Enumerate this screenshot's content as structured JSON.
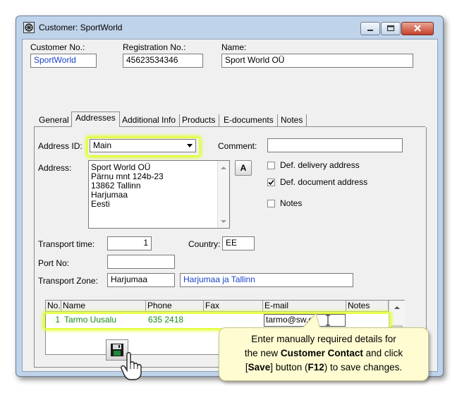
{
  "window": {
    "title": "Customer: SportWorld"
  },
  "header": {
    "customer_no_label": "Customer No.:",
    "customer_no_value": "SportWorld",
    "registration_no_label": "Registration No.:",
    "registration_no_value": "45623534346",
    "name_label": "Name:",
    "name_value": "Sport World OÜ"
  },
  "tabs": [
    {
      "label": "General"
    },
    {
      "label": "Addresses",
      "active": true
    },
    {
      "label": "Additional Info"
    },
    {
      "label": "Products"
    },
    {
      "label": "E-documents"
    },
    {
      "label": "Notes"
    }
  ],
  "address": {
    "address_id_label": "Address ID:",
    "address_id_value": "Main",
    "comment_label": "Comment:",
    "comment_value": "",
    "address_label": "Address:",
    "address_lines": [
      "Sport World OÜ",
      "Pärnu mnt 124b-23",
      "13862 Tallinn",
      "Harjumaa",
      "Eesti"
    ],
    "font_button_label": "A",
    "def_delivery_label": "Def. delivery address",
    "def_delivery_checked": false,
    "def_document_label": "Def. document address",
    "def_document_checked": true,
    "notes_label": "Notes",
    "notes_checked": false,
    "transport_time_label": "Transport time:",
    "transport_time_value": "1",
    "country_label": "Country:",
    "country_value": "EE",
    "port_no_label": "Port No:",
    "port_no_value": "",
    "transport_zone_label": "Transport Zone:",
    "transport_zone_code": "Harjumaa",
    "transport_zone_name": "Harjumaa ja Tallinn"
  },
  "contacts": {
    "columns": [
      "No.",
      "Name",
      "Phone",
      "Fax",
      "E-mail",
      "Notes"
    ],
    "rows": [
      {
        "no": "1",
        "name": "Tarmo Uusalu",
        "phone": "635 2418",
        "fax": "",
        "email": "tarmo@sw.eu",
        "notes": ""
      }
    ]
  },
  "colors": {
    "highlight": "#e5ff3a",
    "link_blue": "#1a44c8",
    "row_green": "#1a8a1a"
  },
  "icons": [
    "customer-window-icon",
    "minimize-icon",
    "maximize-icon",
    "close-icon",
    "dropdown-arrow-icon",
    "save-icon",
    "hand-cursor-icon"
  ],
  "callout": {
    "text_1": "Enter manually required details for",
    "text_2": "the new ",
    "bold_1": "Customer Contact",
    "text_3": " and click",
    "text_4": "[",
    "bold_2": "Save",
    "text_5": "] button (",
    "bold_3": "F12",
    "text_6": ") to save changes."
  }
}
